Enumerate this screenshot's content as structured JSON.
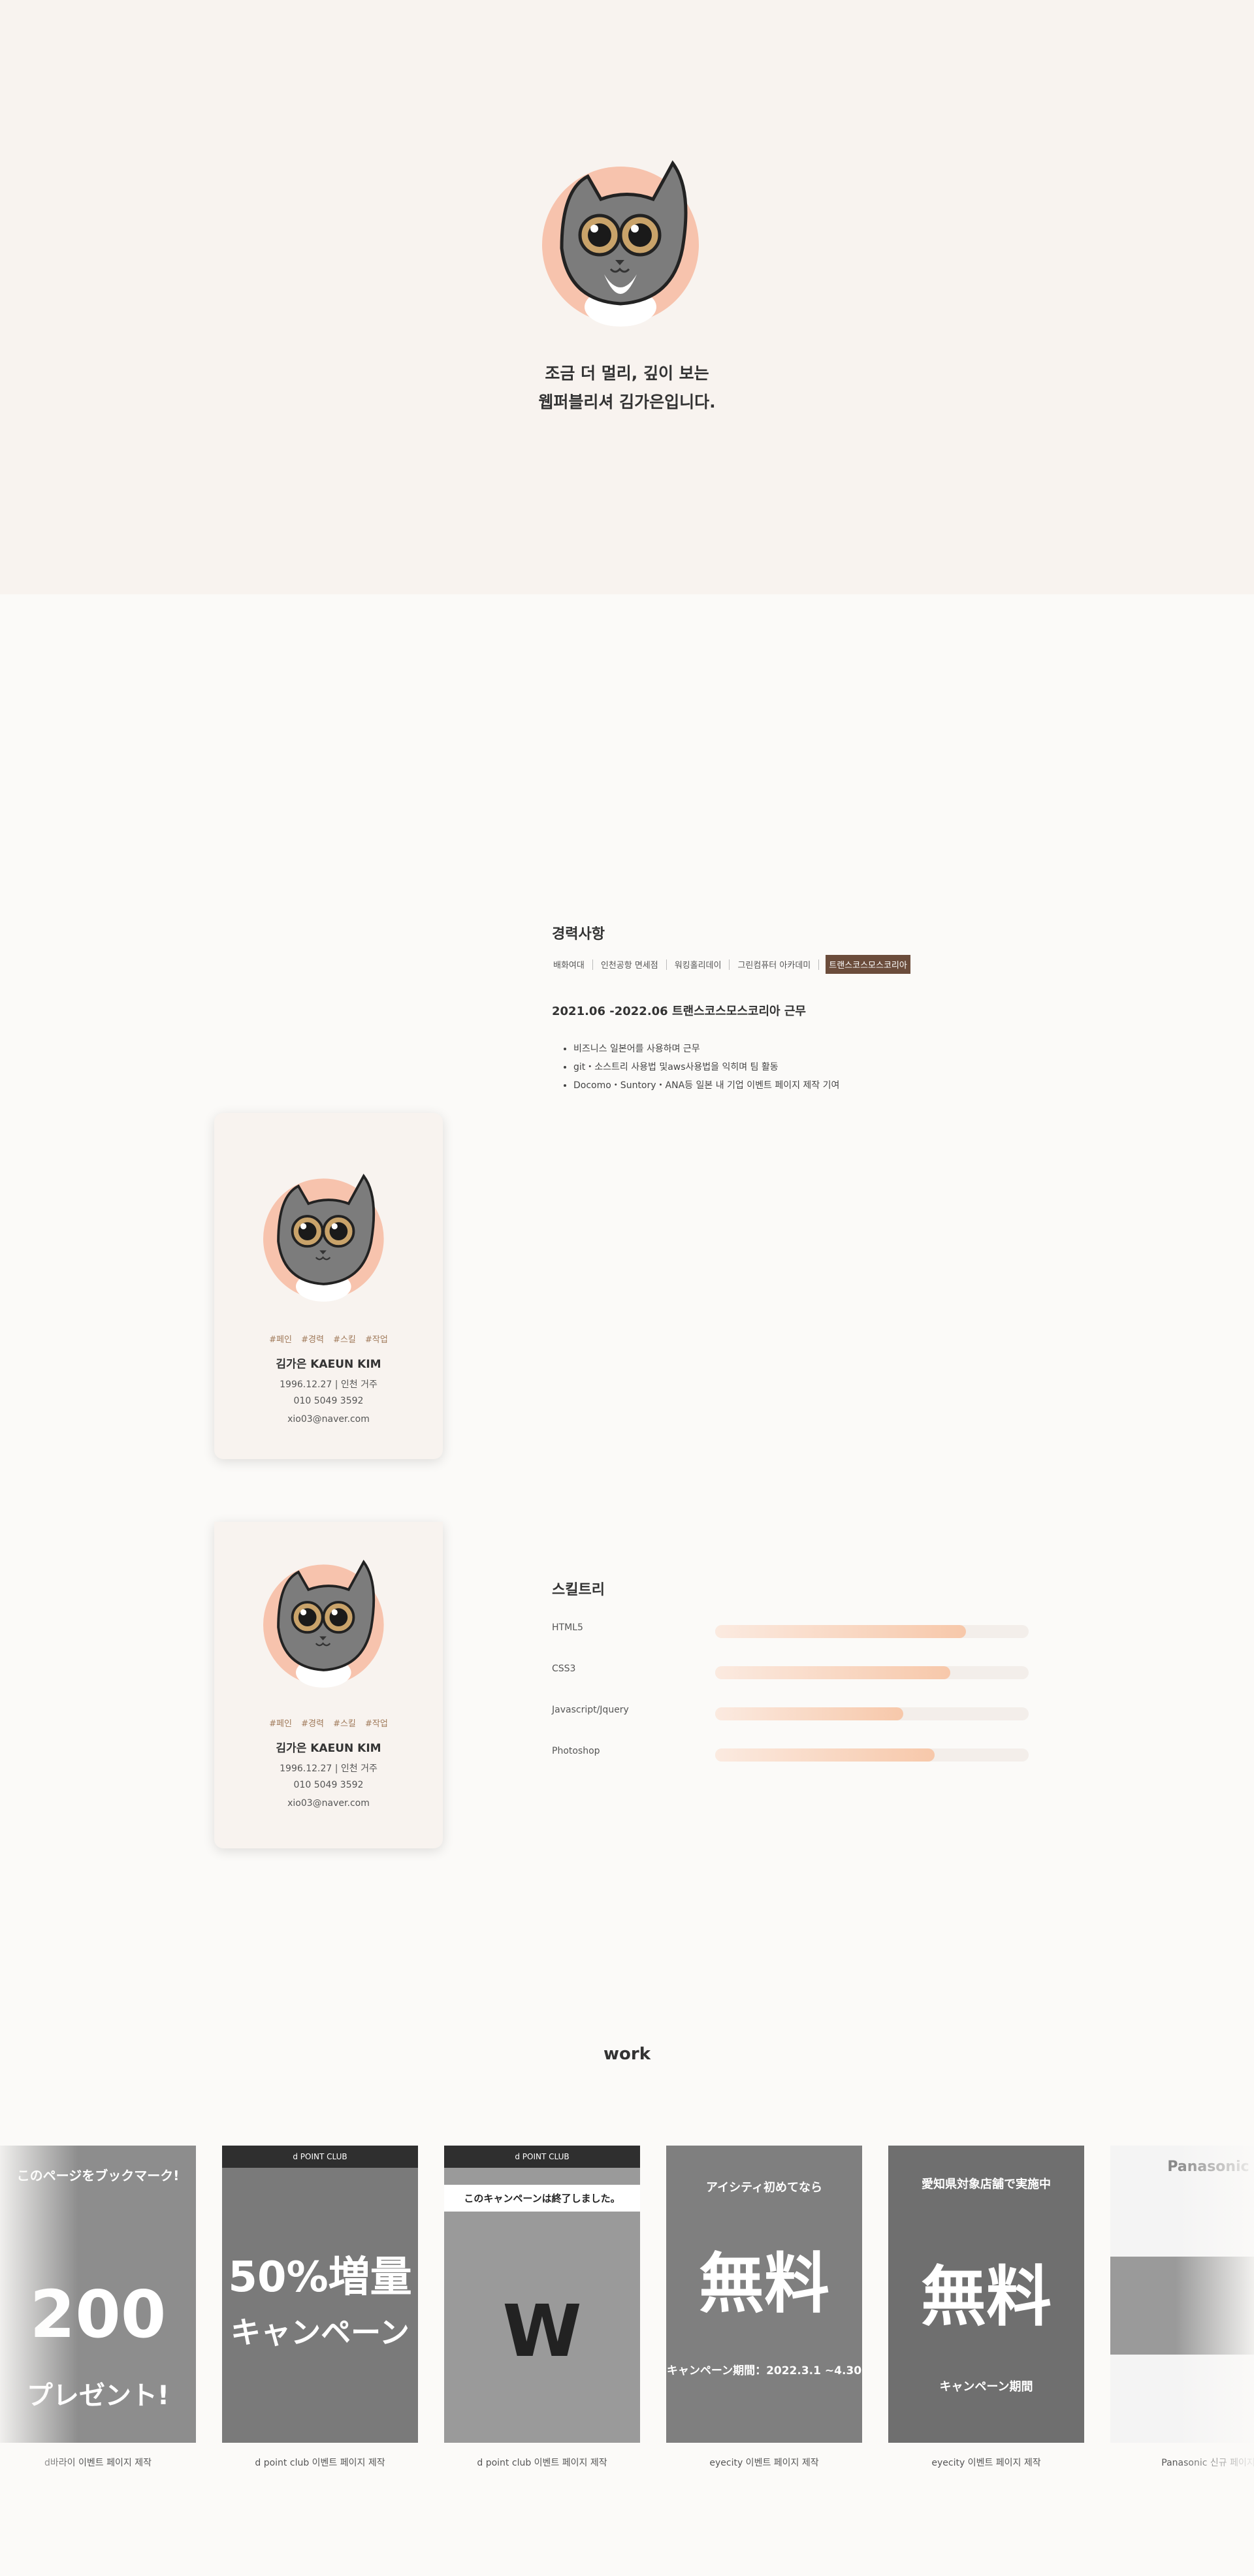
{
  "hero": {
    "line1": "조금 더 멀리, 깊이 보는",
    "line2": "웹퍼블리셔 김가은입니다."
  },
  "profile": {
    "tags": [
      "#페인",
      "#경력",
      "#스킬",
      "#작업"
    ],
    "name": "김가은 KAEUN KIM",
    "birth_location": "1996.12.27 | 인천 거주",
    "phone": "010 5049 3592",
    "email": "xio03@naver.com"
  },
  "career": {
    "title": "경력사항",
    "tabs": [
      "배화여대",
      "인천공항 면세점",
      "워킹홀리데이",
      "그린컴퓨터 아카데미",
      "트랜스코스모스코리아"
    ],
    "active_tab": "트랜스코스모스코리아",
    "heading": "2021.06 -2022.06 트랜스코스모스코리아 근무",
    "items": [
      "비즈니스 일본어를 사용하며 근무",
      "git・소스트리 사용법 및aws사용법을 익히며 팀 활동",
      "Docomo・Suntory・ANA등 일본 내 기업 이벤트 페이지 제작 기여"
    ]
  },
  "skills": {
    "title": "스킬트리",
    "items": [
      {
        "label": "HTML5",
        "level": 0.8
      },
      {
        "label": "CSS3",
        "level": 0.75
      },
      {
        "label": "Javascript/Jquery",
        "level": 0.6
      },
      {
        "label": "Photoshop",
        "level": 0.7
      }
    ]
  },
  "work": {
    "title": "work",
    "items": [
      {
        "caption": "d바라이 이벤트 페이지 제작",
        "thumb_top": "このページをブックマーク!",
        "thumb_main": "200",
        "thumb_sub": "プレゼント!"
      },
      {
        "caption": "d point club 이벤트 페이지 제작",
        "thumb_top": "d POINT CLUB",
        "thumb_main": "50%増量",
        "thumb_sub": "キャンペーン"
      },
      {
        "caption": "d point club 이벤트 페이지 제작",
        "thumb_top": "d POINT CLUB",
        "thumb_main": "W",
        "thumb_sub": "このキャンペーンは終了しました。"
      },
      {
        "caption": "eyecity 이벤트 페이지 제작",
        "thumb_top": "アイシティ初めてなら",
        "thumb_main": "無料",
        "thumb_sub": "キャンペーン期間：2022.3.1 ~4.30"
      },
      {
        "caption": "eyecity 이벤트 페이지 제작",
        "thumb_top": "愛知県対象店舗で実施中",
        "thumb_main": "無料",
        "thumb_sub": "キャンペーン期間"
      },
      {
        "caption": "Panasonic 신규 페이지",
        "thumb_top": "Panasonic",
        "thumb_main": "",
        "thumb_sub": ""
      }
    ]
  },
  "colors": {
    "hero_bg": "#f8f3ef",
    "accent": "#6b4c3b",
    "skill_bar": "#f7c8aa"
  }
}
